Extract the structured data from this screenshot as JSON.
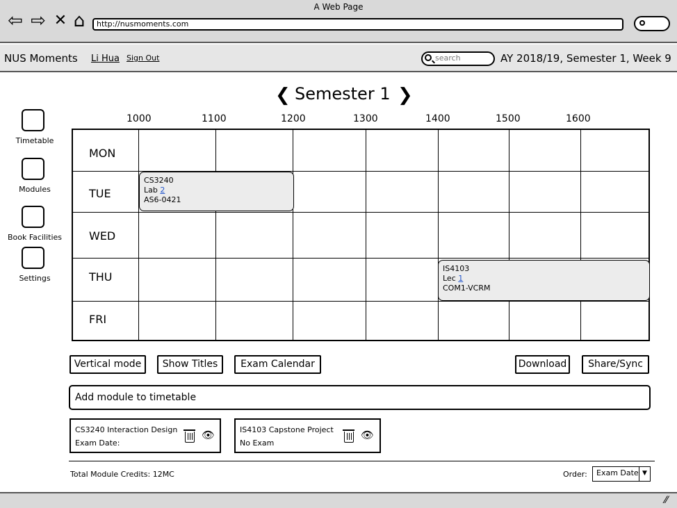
{
  "browser": {
    "title": "A Web Page",
    "url": "http://nusmoments.com"
  },
  "header": {
    "brand": "NUS Moments",
    "user": "Li Hua",
    "signout": "Sign Out",
    "search_placeholder": "search",
    "term": "AY 2018/19, Semester 1, Week 9"
  },
  "sidebar": [
    {
      "label": "Timetable"
    },
    {
      "label": "Modules"
    },
    {
      "label": "Book Facilities"
    },
    {
      "label": "Settings"
    }
  ],
  "semester": {
    "title": "Semester 1",
    "prev": "❮",
    "next": "❯"
  },
  "timetable": {
    "times": [
      "1000",
      "1100",
      "1200",
      "1300",
      "1400",
      "1500",
      "1600"
    ],
    "days": [
      "MON",
      "TUE",
      "WED",
      "THU",
      "FRI"
    ],
    "events": [
      {
        "code": "CS3240",
        "type": "Lab",
        "num": "2",
        "venue": "AS6-0421"
      },
      {
        "code": "IS4103",
        "type": "Lec",
        "num": "1",
        "venue": "COM1-VCRM"
      }
    ]
  },
  "buttons": {
    "vertical": "Vertical mode",
    "titles": "Show Titles",
    "exam": "Exam Calendar",
    "download": "Download",
    "share": "Share/Sync"
  },
  "add_module": "Add module to timetable",
  "modules": [
    {
      "name": "CS3240 Interaction Design",
      "exam": "Exam Date:"
    },
    {
      "name": "IS4103 Capstone Project",
      "exam": "No Exam"
    }
  ],
  "footer": {
    "credits": "Total Module Credits: 12MC",
    "order_label": "Order:",
    "order_value": "Exam Date"
  }
}
